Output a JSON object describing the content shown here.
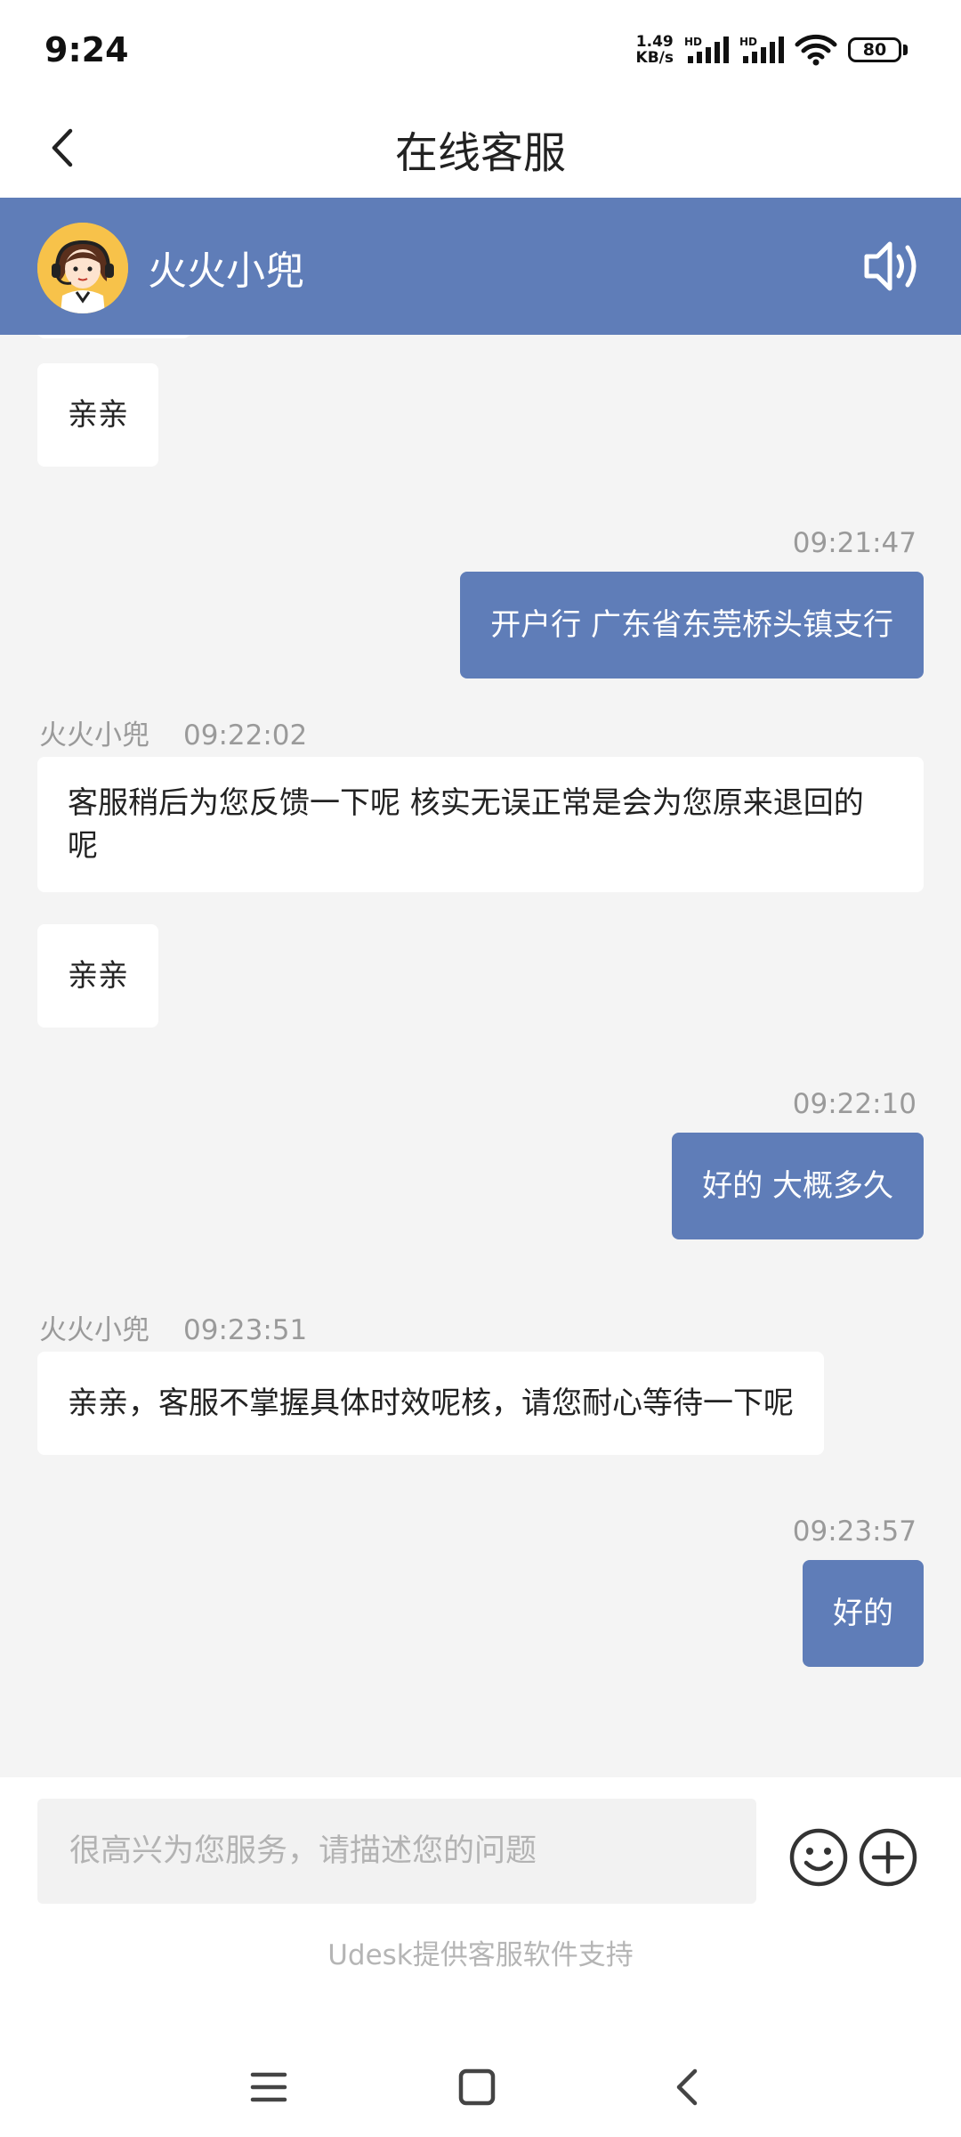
{
  "status_bar": {
    "time": "9:24",
    "net_speed_value": "1.49",
    "net_speed_unit": "KB/s",
    "battery": "80",
    "icons": [
      "hd-signal-icon",
      "hd-signal-icon",
      "wifi-icon",
      "battery-icon"
    ]
  },
  "header": {
    "title": "在线客服",
    "back_icon": "chevron-left-icon"
  },
  "agent_bar": {
    "name": "火火小兜",
    "avatar_icon": "agent-avatar-headset",
    "speaker_icon": "speaker-icon",
    "background": "#5f7db8"
  },
  "messages": [
    {
      "side": "left",
      "text": "亲亲"
    },
    {
      "side": "right",
      "time": "09:21:47",
      "text": "开户行 广东省东莞桥头镇支行"
    },
    {
      "side": "left",
      "sender": "火火小兜",
      "time": "09:22:02",
      "text": "客服稍后为您反馈一下呢 核实无误正常是会为您原来退回的呢"
    },
    {
      "side": "left",
      "text": "亲亲"
    },
    {
      "side": "right",
      "time": "09:22:10",
      "text": "好的 大概多久"
    },
    {
      "side": "left",
      "sender": "火火小兜",
      "time": "09:23:51",
      "text": "亲亲，客服不掌握具体时效呢核，请您耐心等待一下呢"
    },
    {
      "side": "right",
      "time": "09:23:57",
      "text": "好的"
    }
  ],
  "composer": {
    "placeholder": "很高兴为您服务，请描述您的问题",
    "emoji_icon": "smiley-icon",
    "plus_icon": "plus-circle-icon"
  },
  "footer": {
    "powered_by": "Udesk提供客服软件支持"
  },
  "nav_bar": {
    "icons": [
      "menu-icon",
      "home-square-icon",
      "back-icon"
    ]
  }
}
